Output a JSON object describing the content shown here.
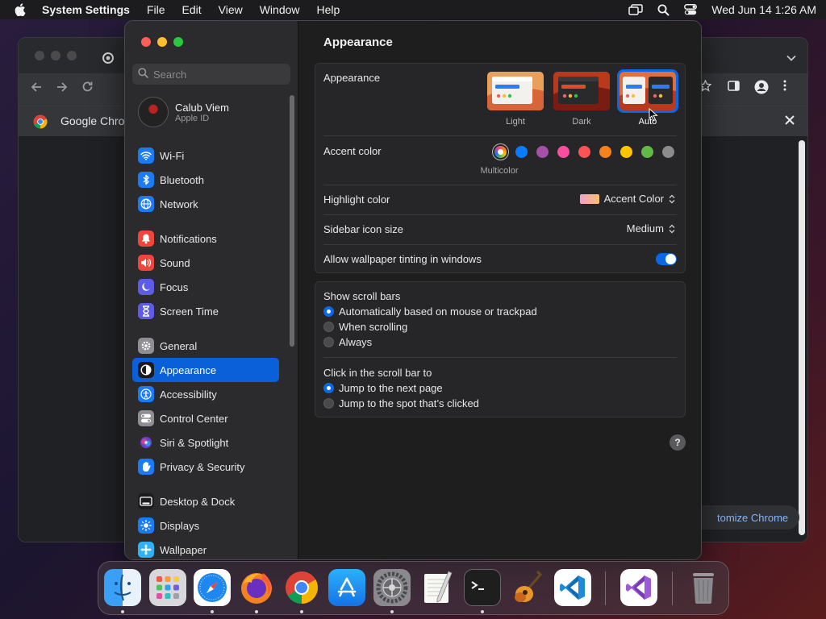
{
  "menubar": {
    "app_name": "System Settings",
    "menus": [
      "File",
      "Edit",
      "View",
      "Window",
      "Help"
    ],
    "datetime": "Wed Jun 14  1:26 AM"
  },
  "chrome": {
    "infobar_text": "Google Chrome",
    "customize_label": "Customize Chrome",
    "customize_visible": "tomize Chrome"
  },
  "settings": {
    "search": {
      "placeholder": "Search"
    },
    "account": {
      "name": "Calub Viem",
      "subtitle": "Apple ID"
    },
    "sidebar": {
      "groups": [
        [
          {
            "label": "Wi-Fi",
            "icon": "wifi-icon",
            "color": "#1a7cf5"
          },
          {
            "label": "Bluetooth",
            "icon": "bluetooth-icon",
            "color": "#1a7cf5"
          },
          {
            "label": "Network",
            "icon": "globe-icon",
            "color": "#1a7cf5"
          }
        ],
        [
          {
            "label": "Notifications",
            "icon": "bell-icon",
            "color": "#f0453a"
          },
          {
            "label": "Sound",
            "icon": "speaker-icon",
            "color": "#f0453a"
          },
          {
            "label": "Focus",
            "icon": "moon-icon",
            "color": "#5e5ce6"
          },
          {
            "label": "Screen Time",
            "icon": "hourglass-icon",
            "color": "#5e5ce6"
          }
        ],
        [
          {
            "label": "General",
            "icon": "gear-icon",
            "color": "#8e8e93"
          },
          {
            "label": "Appearance",
            "icon": "appearance-icon",
            "color": "#1c1c1e",
            "selected": true
          },
          {
            "label": "Accessibility",
            "icon": "accessibility-icon",
            "color": "#1a7cf5"
          },
          {
            "label": "Control Center",
            "icon": "control-center-icon",
            "color": "#8e8e93"
          },
          {
            "label": "Siri & Spotlight",
            "icon": "siri-icon",
            "color": "#2c2c2e"
          },
          {
            "label": "Privacy & Security",
            "icon": "hand-icon",
            "color": "#1a7cf5"
          }
        ],
        [
          {
            "label": "Desktop & Dock",
            "icon": "dock-icon",
            "color": "#1c1c1e"
          },
          {
            "label": "Displays",
            "icon": "sun-icon",
            "color": "#1a7cf5"
          },
          {
            "label": "Wallpaper",
            "icon": "wallpaper-icon",
            "color": "#30b0f5"
          }
        ]
      ]
    },
    "main": {
      "title": "Appearance",
      "appearance_label": "Appearance",
      "appearance_options": [
        {
          "label": "Light",
          "selected": false
        },
        {
          "label": "Dark",
          "selected": false
        },
        {
          "label": "Auto",
          "selected": true
        }
      ],
      "accent_label": "Accent color",
      "accent_colors": [
        "multicolor",
        "#0a7cff",
        "#a550a7",
        "#f74f9e",
        "#ff5257",
        "#f7821b",
        "#ffc600",
        "#62ba46",
        "#8c8c8c"
      ],
      "accent_selected_name": "Multicolor",
      "highlight_label": "Highlight color",
      "highlight_value": "Accent Color",
      "sidebar_icon_label": "Sidebar icon size",
      "sidebar_icon_value": "Medium",
      "wallpaper_tint_label": "Allow wallpaper tinting in windows",
      "wallpaper_tint_on": true,
      "scroll_bars_label": "Show scroll bars",
      "scroll_bar_options": [
        {
          "label": "Automatically based on mouse or trackpad",
          "selected": true
        },
        {
          "label": "When scrolling",
          "selected": false
        },
        {
          "label": "Always",
          "selected": false
        }
      ],
      "click_label": "Click in the scroll bar to",
      "click_options": [
        {
          "label": "Jump to the next page",
          "selected": true
        },
        {
          "label": "Jump to the spot that’s clicked",
          "selected": false
        }
      ],
      "help": "?"
    }
  },
  "dock": {
    "apps": [
      "finder-icon",
      "launchpad-icon",
      "safari-icon",
      "firefox-icon",
      "chrome-icon",
      "app-store-icon",
      "system-settings-icon",
      "textedit-icon",
      "terminal-icon",
      "garageband-icon",
      "vscode-icon",
      "visual-studio-icon",
      "trash-icon"
    ]
  }
}
